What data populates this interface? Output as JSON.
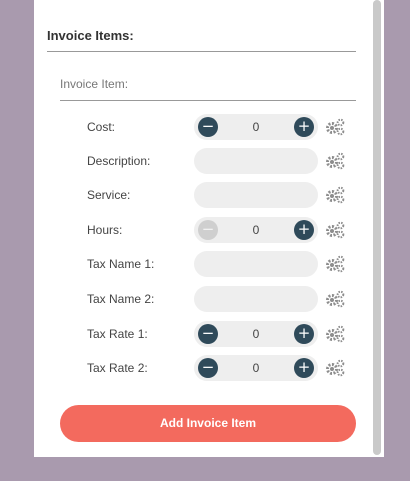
{
  "section": {
    "title": "Invoice Items:"
  },
  "subsection": {
    "title": "Invoice Item:"
  },
  "rows": [
    {
      "label": "Cost:",
      "value": "0"
    },
    {
      "label": "Description:",
      "value": ""
    },
    {
      "label": "Service:",
      "value": ""
    },
    {
      "label": "Hours:",
      "value": "0"
    },
    {
      "label": "Tax Name 1:",
      "value": ""
    },
    {
      "label": "Tax Name 2:",
      "value": ""
    },
    {
      "label": "Tax Rate 1:",
      "value": "0"
    },
    {
      "label": "Tax Rate 2:",
      "value": "0"
    }
  ],
  "controls": {
    "minus_symbol": "−",
    "plus_symbol": "+",
    "settings_icon": "gears-icon"
  },
  "add_button": {
    "label": "Add Invoice Item"
  },
  "colors": {
    "background": "#a99aae",
    "accent": "#f36a5e",
    "stepper": "#2f4a5a",
    "stepper_disabled": "#cfcfcf",
    "field": "#eeeeee",
    "gear": "#8d8d8d"
  }
}
